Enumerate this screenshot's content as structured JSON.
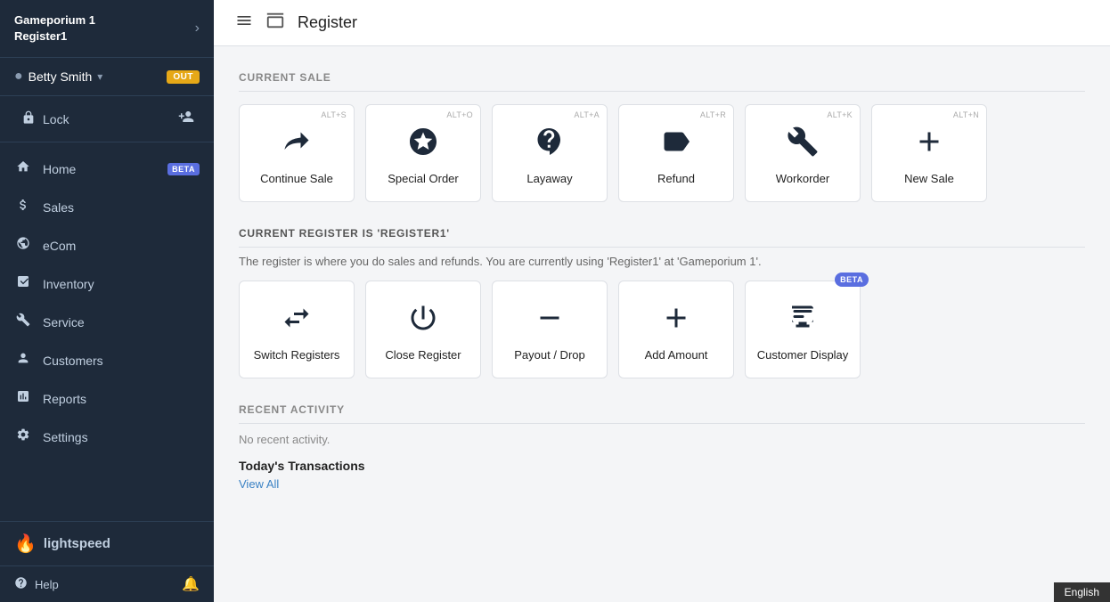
{
  "sidebar": {
    "header": {
      "title_line1": "Gameporium 1",
      "title_line2": "Register1",
      "arrow": "›"
    },
    "user": {
      "name": "Betty Smith",
      "chevron": "▾",
      "badge": "OUT"
    },
    "lock": {
      "label": "Lock"
    },
    "nav_items": [
      {
        "id": "home",
        "label": "Home",
        "icon": "home",
        "badge": "BETA"
      },
      {
        "id": "sales",
        "label": "Sales",
        "icon": "sales",
        "badge": null
      },
      {
        "id": "ecom",
        "label": "eCom",
        "icon": "ecom",
        "badge": null
      },
      {
        "id": "inventory",
        "label": "Inventory",
        "icon": "inventory",
        "badge": null
      },
      {
        "id": "service",
        "label": "Service",
        "icon": "service",
        "badge": null
      },
      {
        "id": "customers",
        "label": "Customers",
        "icon": "customers",
        "badge": null
      },
      {
        "id": "reports",
        "label": "Reports",
        "icon": "reports",
        "badge": null
      },
      {
        "id": "settings",
        "label": "Settings",
        "icon": "settings",
        "badge": null
      }
    ],
    "logo": "lightspeed",
    "bottom": {
      "help": "Help",
      "notification_icon": "🔔"
    }
  },
  "topbar": {
    "title": "Register"
  },
  "current_sale": {
    "section_label": "CURRENT SALE",
    "cards": [
      {
        "id": "continue-sale",
        "label": "Continue Sale",
        "shortcut": "ALT+S",
        "icon": "continue"
      },
      {
        "id": "special-order",
        "label": "Special Order",
        "shortcut": "ALT+O",
        "icon": "special"
      },
      {
        "id": "layaway",
        "label": "Layaway",
        "shortcut": "ALT+A",
        "icon": "layaway"
      },
      {
        "id": "refund",
        "label": "Refund",
        "shortcut": "ALT+R",
        "icon": "refund"
      },
      {
        "id": "workorder",
        "label": "Workorder",
        "shortcut": "ALT+K",
        "icon": "workorder"
      },
      {
        "id": "new-sale",
        "label": "New Sale",
        "shortcut": "ALT+N",
        "icon": "new-sale"
      }
    ]
  },
  "register_section": {
    "title": "CURRENT REGISTER IS 'REGISTER1'",
    "description": "The register is where you do sales and refunds. You are currently using 'Register1'  at 'Gameporium 1'.",
    "cards": [
      {
        "id": "switch-registers",
        "label": "Switch Registers",
        "icon": "switch",
        "beta": false
      },
      {
        "id": "close-register",
        "label": "Close Register",
        "icon": "close-reg",
        "beta": false
      },
      {
        "id": "payout-drop",
        "label": "Payout / Drop",
        "icon": "payout",
        "beta": false
      },
      {
        "id": "add-amount",
        "label": "Add Amount",
        "icon": "add-amount",
        "beta": false
      },
      {
        "id": "customer-display",
        "label": "Customer Display",
        "icon": "customer-display",
        "beta": true
      }
    ]
  },
  "recent_activity": {
    "section_label": "RECENT ACTIVITY",
    "no_activity": "No recent activity.",
    "todays_transactions": "Today's Transactions",
    "view_all": "View All"
  },
  "footer": {
    "language": "English"
  }
}
